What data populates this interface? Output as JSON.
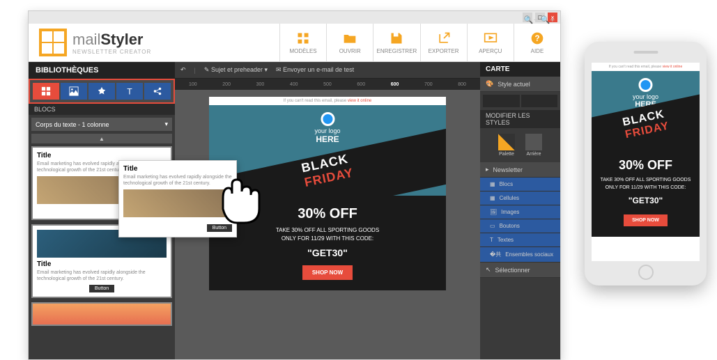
{
  "logo": {
    "name": "mail",
    "bold": "Styler",
    "sub": "NEWSLETTER CREATOR"
  },
  "toolbar": [
    {
      "label": "MODÈLES"
    },
    {
      "label": "OUVRIR"
    },
    {
      "label": "ENREGISTRER"
    },
    {
      "label": "EXPORTER"
    },
    {
      "label": "APERÇU"
    },
    {
      "label": "AIDE"
    }
  ],
  "sidebar": {
    "title": "BIBLIOTHÈQUES",
    "blocs_label": "BLOCS",
    "dropdown": "Corps du texte - 1 colonne",
    "block": {
      "title": "Title",
      "desc": "Email marketing has evolved rapidly alongside the technological growth of the 21st century.",
      "button": "Button"
    }
  },
  "canvas": {
    "subject": "Sujet et preheader",
    "sendtest": "Envoyer un e-mail de test",
    "ruler": [
      "100",
      "200",
      "300",
      "400",
      "500",
      "600",
      "600",
      "700",
      "800"
    ],
    "preview_text": "If you can't read this email, please ",
    "preview_link": "view it online"
  },
  "email": {
    "logo_line1": "your logo",
    "logo_line2": "HERE",
    "bf": "BLACK FRIDAY",
    "discount": "30% OFF",
    "line1": "TAKE 30% OFF ALL SPORTING GOODS",
    "line2": "ONLY FOR 11/29 WITH THIS CODE:",
    "code": "\"GET30\"",
    "cta": "SHOP NOW"
  },
  "right": {
    "carte": "CARTE",
    "style": "Style actuel",
    "modifier": "MODIFIER LES STYLES",
    "palette": "Palette",
    "arriere": "Arrière",
    "items": [
      "Newsletter",
      "Blocs",
      "Cellules",
      "Images",
      "Boutons",
      "Textes",
      "Ensembles sociaux"
    ],
    "selectionner": "Sélectionner"
  }
}
